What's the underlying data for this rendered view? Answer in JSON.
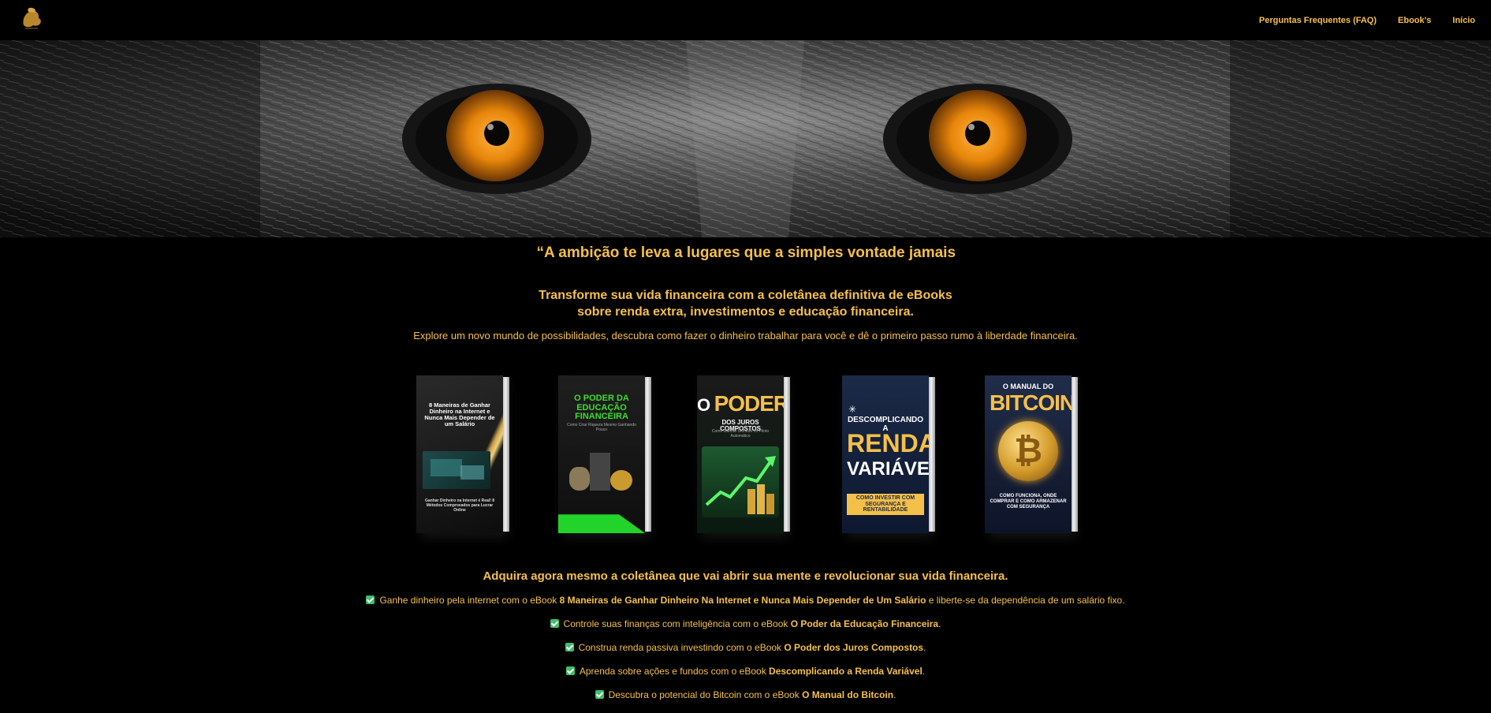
{
  "nav": {
    "logo": "lion-logo",
    "links": [
      {
        "label": "Perguntas Frequentes (FAQ)"
      },
      {
        "label": "Ebook's"
      },
      {
        "label": "Início"
      }
    ]
  },
  "hero": {
    "image": "lion-eyes-banner",
    "eye_color": "#f0900c"
  },
  "quote": "“A ambição te leva a lugares que a simples vontade jamais",
  "headline": {
    "line1": "Transforme sua vida financeira com a coletânea definitiva de eBooks",
    "line2": "sobre renda extra, investimentos e educação financeira."
  },
  "subheadline": "Explore um novo mundo de possibilidades, descubra como fazer o dinheiro trabalhar para você e dê o primeiro passo rumo à liberdade financeira.",
  "books": [
    {
      "title": "8 Maneiras de Ganhar Dinheiro na Internet e Nunca Mais Depender de um Salário",
      "subtitle": "Ganhar Dinheiro na Internet é Real! 8 Métodos Comprovados para Lucrar Online"
    },
    {
      "title": "O PODER DA EDUCAÇÃO FINANCEIRA",
      "subtitle": "Como Criar Riqueza Mesmo Ganhando Pouco"
    },
    {
      "title_small": "O",
      "title_big": "PODER",
      "title_rest": "DOS JUROS COMPOSTOS",
      "subtitle": "Como Ganhar Dinheiro no Piloto Automático"
    },
    {
      "title_top": "DESCOMPLICANDO A",
      "title_big": "RENDA",
      "title_mid": "VARIÁVEL",
      "subtitle": "COMO INVESTIR COM SEGURANÇA E RENTABILIDADE"
    },
    {
      "title_top": "O MANUAL DO",
      "title_big": "BITCOIN",
      "subtitle": "COMO FUNCIONA, ONDE COMPRAR E COMO ARMAZENAR COM SEGURANÇA",
      "coin_symbol": "₿"
    }
  ],
  "cta": "Adquira agora mesmo a coletânea que vai abrir sua mente e revolucionar sua vida financeira.",
  "benefits": [
    {
      "pre": "Ganhe dinheiro pela internet com o eBook ",
      "bold": "8 Maneiras de Ganhar Dinheiro Na Internet e Nunca Mais Depender de Um Salário",
      "post": " e liberte-se da dependência de um salário fixo."
    },
    {
      "pre": "Controle suas finanças com inteligência com o eBook ",
      "bold": "O Poder da Educação Financeira",
      "post": "."
    },
    {
      "pre": "Construa renda passiva investindo com o eBook ",
      "bold": "O Poder dos Juros Compostos",
      "post": "."
    },
    {
      "pre": "Aprenda sobre ações e fundos com o eBook ",
      "bold": "Descomplicando a Renda Variável",
      "post": "."
    },
    {
      "pre": "Descubra o potencial do Bitcoin com o eBook ",
      "bold": "O Manual do Bitcoin",
      "post": "."
    }
  ],
  "colors": {
    "accent": "#f5c04a",
    "background": "#000000",
    "check": "#3fbf6a"
  }
}
